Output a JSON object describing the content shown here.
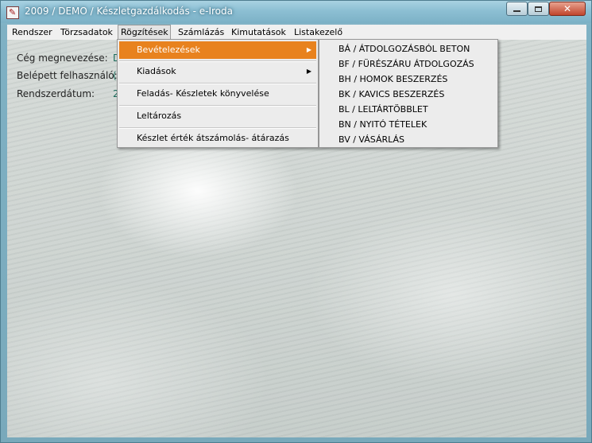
{
  "window": {
    "title": "2009 / DEMO / Készletgazdálkodás - e-Iroda",
    "app_icon": "app-icon",
    "controls": {
      "minimize": "minimize-icon",
      "maximize": "maximize-icon",
      "close_symbol": "✕"
    }
  },
  "menubar": {
    "items": [
      {
        "label": "Rendszer"
      },
      {
        "label": "Törzsadatok"
      },
      {
        "label": "Rögzítések",
        "active": true
      },
      {
        "label": "Számlázás"
      },
      {
        "label": "Kimutatások"
      },
      {
        "label": "Listakezelő"
      }
    ]
  },
  "info": {
    "company_label": "Cég megnevezése:",
    "company_value": "D",
    "user_label": "Belépett felhasználó:",
    "user_value": "(",
    "date_label": "Rendszerdátum:",
    "date_value": "2"
  },
  "rogzitesek_menu": {
    "items": [
      {
        "label": "Bevételezések",
        "has_submenu": true,
        "highlighted": true
      },
      {
        "label": "Kiadások",
        "has_submenu": true
      },
      {
        "label": "Feladás- Készletek könyvelése"
      },
      {
        "label": "Leltározás"
      },
      {
        "label": "Készlet érték átszámolás- átárazás"
      }
    ]
  },
  "bevetelezesek_submenu": {
    "items": [
      {
        "label": "BÁ / ÁTDOLGOZÁSBÓL BETON"
      },
      {
        "label": "BF / FÜRÉSZÁRU ÁTDOLGOZÁS"
      },
      {
        "label": "BH / HOMOK BESZERZÉS"
      },
      {
        "label": "BK / KAVICS BESZERZÉS"
      },
      {
        "label": "BL / LELTÁRTÖBBLET"
      },
      {
        "label": "BN / NYITÓ TÉTELEK"
      },
      {
        "label": "BV / VÁSÁRLÁS"
      }
    ]
  },
  "colors": {
    "highlight": "#e8821e",
    "menu_bg": "#ececec",
    "title_text": "#ffffff"
  }
}
